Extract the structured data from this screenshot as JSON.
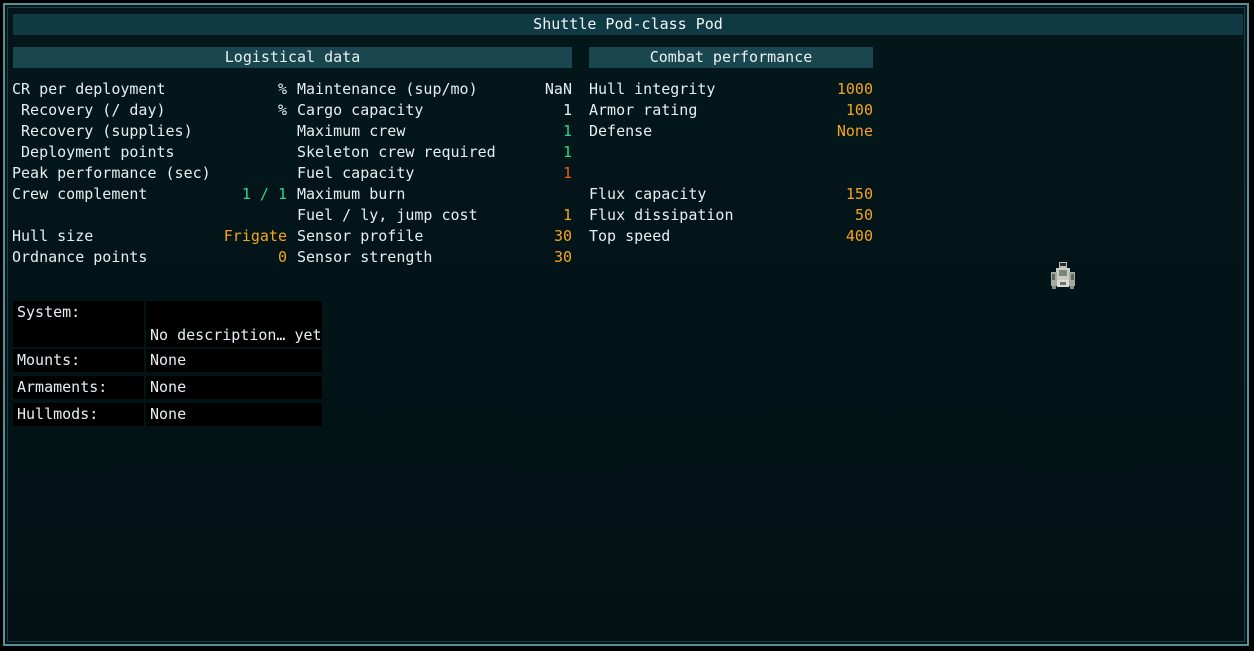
{
  "window": {
    "title": "Shuttle Pod-class Pod"
  },
  "logistical": {
    "header": "Logistical data",
    "left": [
      {
        "label": "CR per deployment",
        "value": "%",
        "color": "#e6eef0"
      },
      {
        "label": " Recovery (/ day)",
        "value": "%",
        "color": "#e6eef0"
      },
      {
        "label": " Recovery (supplies)",
        "value": "",
        "color": "#e6eef0"
      },
      {
        "label": " Deployment points",
        "value": "",
        "color": "#e6eef0"
      },
      {
        "label": "Peak performance (sec)",
        "value": "",
        "color": "#e6eef0"
      },
      {
        "label": "Crew complement",
        "value": "1 / 1",
        "color": "#27d88f"
      },
      {
        "label": "",
        "value": "",
        "color": "#e6eef0"
      },
      {
        "label": "Hull size",
        "value": "Frigate",
        "color": "#f7a41c"
      },
      {
        "label": "Ordnance points",
        "value": "0",
        "color": "#f7a41c"
      }
    ],
    "right": [
      {
        "label": "Maintenance (sup/mo)",
        "value": "NaN",
        "color": "#e6eef0"
      },
      {
        "label": "Cargo capacity",
        "value": "1",
        "color": "#e6eef0"
      },
      {
        "label": "Maximum crew",
        "value": "1",
        "color": "#27d88f"
      },
      {
        "label": "Skeleton crew required",
        "value": "1",
        "color": "#27d88f"
      },
      {
        "label": "Fuel capacity",
        "value": "1",
        "color": "#f0581e"
      },
      {
        "label": "Maximum burn",
        "value": "",
        "color": "#e6eef0"
      },
      {
        "label": "Fuel / ly, jump cost",
        "value": "1",
        "color": "#f7a41c"
      },
      {
        "label": "Sensor profile",
        "value": "30",
        "color": "#f7a41c"
      },
      {
        "label": "Sensor strength",
        "value": "30",
        "color": "#f7a41c"
      }
    ]
  },
  "combat": {
    "header": "Combat performance",
    "rows": [
      {
        "label": "Hull integrity",
        "value": "1000",
        "color": "#f7a41c"
      },
      {
        "label": "Armor rating",
        "value": "100",
        "color": "#f7a41c"
      },
      {
        "label": "Defense",
        "value": "None",
        "color": "#f7a41c"
      },
      {
        "label": "",
        "value": "",
        "color": "#f7a41c"
      },
      {
        "label": "",
        "value": "",
        "color": "#f7a41c"
      },
      {
        "label": "Flux capacity",
        "value": "150",
        "color": "#f7a41c"
      },
      {
        "label": "Flux dissipation",
        "value": "50",
        "color": "#f7a41c"
      },
      {
        "label": "Top speed",
        "value": "400",
        "color": "#f7a41c"
      }
    ]
  },
  "description": {
    "system_label": "System:",
    "system_value": "No description… yet",
    "mounts_label": "Mounts:",
    "mounts_value": "None",
    "armaments_label": "Armaments:",
    "armaments_value": "None",
    "hullmods_label": "Hullmods:",
    "hullmods_value": "None"
  },
  "ship_icon": "shuttle-sprite-icon"
}
